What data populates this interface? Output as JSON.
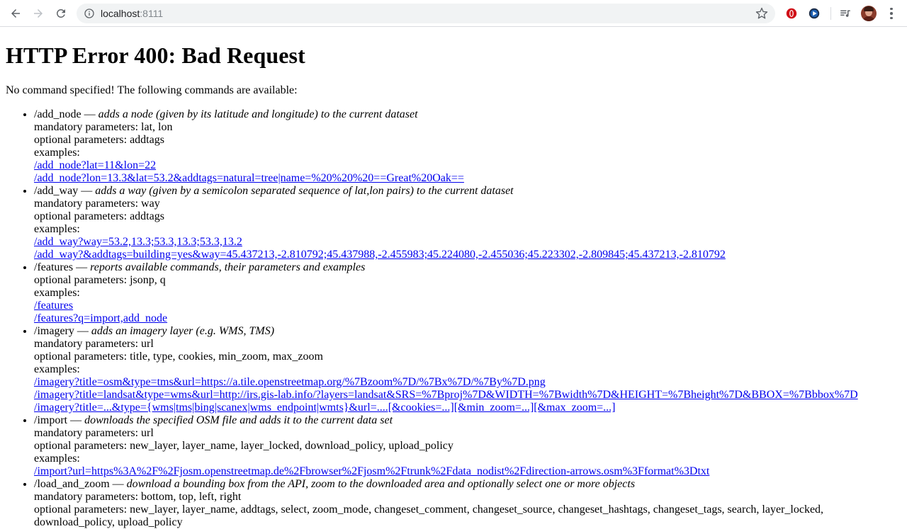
{
  "browser": {
    "url_host": "localhost",
    "url_port": ":8111"
  },
  "page": {
    "title": "HTTP Error 400: Bad Request",
    "intro": "No command specified! The following commands are available:",
    "commands": [
      {
        "name": "/add_node",
        "description": "adds a node (given by its latitude and longitude) to the current dataset",
        "mandatory": "mandatory parameters: lat, lon",
        "optional": "optional parameters: addtags",
        "examples_label": "examples:",
        "examples": [
          "/add_node?lat=11&lon=22",
          "/add_node?lon=13.3&lat=53.2&addtags=natural=tree|name=%20%20%20==Great%20Oak=="
        ]
      },
      {
        "name": "/add_way",
        "description": "adds a way (given by a semicolon separated sequence of lat,lon pairs) to the current dataset",
        "mandatory": "mandatory parameters: way",
        "optional": "optional parameters: addtags",
        "examples_label": "examples:",
        "examples": [
          "/add_way?way=53.2,13.3;53.3,13.3;53.3,13.2",
          "/add_way?&addtags=building=yes&way=45.437213,-2.810792;45.437988,-2.455983;45.224080,-2.455036;45.223302,-2.809845;45.437213,-2.810792"
        ]
      },
      {
        "name": "/features",
        "description": "reports available commands, their parameters and examples",
        "mandatory": "",
        "optional": "optional parameters: jsonp, q",
        "examples_label": "examples:",
        "examples": [
          "/features",
          "/features?q=import,add_node"
        ]
      },
      {
        "name": "/imagery",
        "description": "adds an imagery layer (e.g. WMS, TMS)",
        "mandatory": "mandatory parameters: url",
        "optional": "optional parameters: title, type, cookies, min_zoom, max_zoom",
        "examples_label": "examples:",
        "examples": [
          "/imagery?title=osm&type=tms&url=https://a.tile.openstreetmap.org/%7Bzoom%7D/%7Bx%7D/%7By%7D.png",
          "/imagery?title=landsat&type=wms&url=http://irs.gis-lab.info/?layers=landsat&SRS=%7Bproj%7D&WIDTH=%7Bwidth%7D&HEIGHT=%7Bheight%7D&BBOX=%7Bbbox%7D",
          "/imagery?title=...&type={wms|tms|bing|scanex|wms_endpoint|wmts}&url=....[&cookies=...][&min_zoom=...][&max_zoom=...]"
        ]
      },
      {
        "name": "/import",
        "description": "downloads the specified OSM file and adds it to the current data set",
        "mandatory": "mandatory parameters: url",
        "optional": "optional parameters: new_layer, layer_name, layer_locked, download_policy, upload_policy",
        "examples_label": "examples:",
        "examples": [
          "/import?url=https%3A%2F%2Fjosm.openstreetmap.de%2Fbrowser%2Fjosm%2Ftrunk%2Fdata_nodist%2Fdirection-arrows.osm%3Fformat%3Dtxt"
        ]
      },
      {
        "name": "/load_and_zoom",
        "description": "download a bounding box from the API, zoom to the downloaded area and optionally select one or more objects",
        "mandatory": "mandatory parameters: bottom, top, left, right",
        "optional": "optional parameters: new_layer, layer_name, addtags, select, zoom_mode, changeset_comment, changeset_source, changeset_hashtags, changeset_tags, search, layer_locked,",
        "optional_cont": "download_policy, upload_policy",
        "examples_label": "",
        "examples": []
      }
    ]
  }
}
